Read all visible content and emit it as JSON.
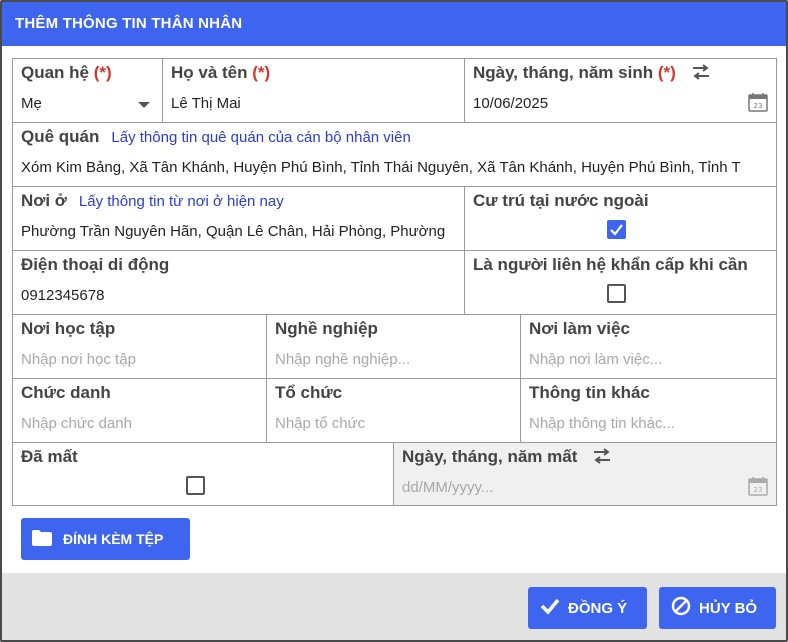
{
  "dialog": {
    "title": "THÊM THÔNG TIN THÂN NHÂN"
  },
  "form": {
    "relation": {
      "label": "Quan hệ",
      "required_mark": "(*)",
      "value": "Mẹ"
    },
    "full_name": {
      "label": "Họ và tên",
      "required_mark": "(*)",
      "value": "Lê Thị Mai"
    },
    "birth_date": {
      "label": "Ngày, tháng, năm sinh",
      "required_mark": "(*)",
      "value": "10/06/2025"
    },
    "hometown": {
      "label": "Quê quán",
      "link": "Lấy thông tin quê quán của cán bộ nhân viên",
      "value": "Xóm Kim Bảng, Xã Tân Khánh, Huyện Phú Bình, Tỉnh Thái Nguyên, Xã Tân Khánh, Huyện Phú Bình, Tỉnh T"
    },
    "residence": {
      "label": "Nơi ở",
      "link": "Lấy thông tin từ nơi ở hiện nay",
      "value": "Phường Trần Nguyên Hãn, Quận Lê Chân, Hải Phòng, Phường"
    },
    "abroad": {
      "label": "Cư trú tại nước ngoài",
      "checked": true
    },
    "mobile": {
      "label": "Điện thoại di động",
      "value": "0912345678"
    },
    "emergency_contact": {
      "label": "Là người liên hệ khẩn cấp khi cần",
      "checked": false
    },
    "study_place": {
      "label": "Nơi học tập",
      "placeholder": "Nhập nơi học tập"
    },
    "occupation": {
      "label": "Nghề nghiệp",
      "placeholder": "Nhập nghề nghiệp..."
    },
    "workplace": {
      "label": "Nơi làm việc",
      "placeholder": "Nhập nơi làm việc..."
    },
    "position": {
      "label": "Chức danh",
      "placeholder": "Nhập chức danh"
    },
    "organization": {
      "label": "Tổ chức",
      "placeholder": "Nhập tổ chức"
    },
    "other_info": {
      "label": "Thông tin khác",
      "placeholder": "Nhập thông tin khác..."
    },
    "deceased": {
      "label": "Đã mất",
      "checked": false
    },
    "death_date": {
      "label": "Ngày, tháng, năm mất",
      "placeholder": "dd/MM/yyyy..."
    },
    "calendar_day": "23"
  },
  "attach_button": {
    "label": "ĐÍNH KÈM TỆP",
    "icon": "folder-icon"
  },
  "footer": {
    "confirm": {
      "label": "ĐỒNG Ý",
      "icon": "check-icon"
    },
    "cancel": {
      "label": "HỦY BỎ",
      "icon": "cancel-circle-icon"
    }
  },
  "colors": {
    "accent": "#3d65f0",
    "required": "#d9342b",
    "link": "#2b3bd6",
    "footer_bg": "#e2e2e2"
  }
}
